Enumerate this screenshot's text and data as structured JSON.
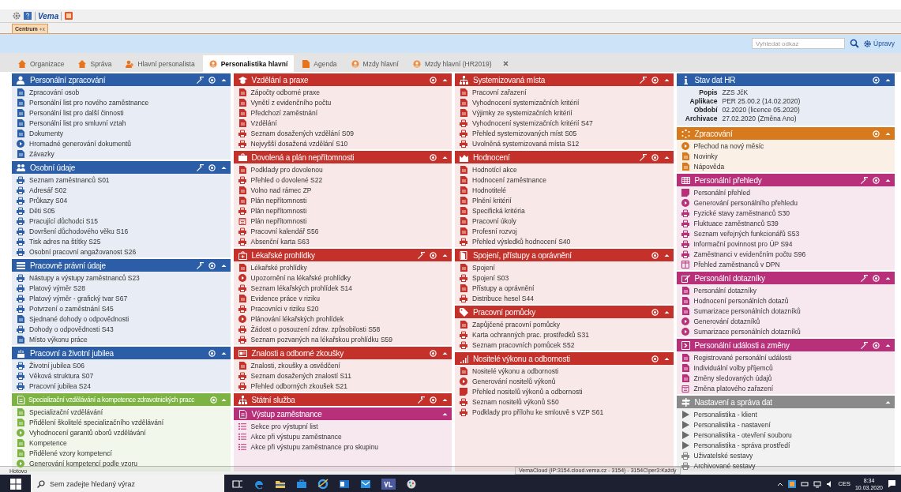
{
  "toolbar": {
    "brand": "Vema"
  },
  "doc_tab": {
    "label": "Centrum"
  },
  "search": {
    "placeholder": "Vyhledat odkaz",
    "edit_label": "Úpravy"
  },
  "tabs": [
    {
      "label": "Organizace",
      "kind": "home",
      "selected": false
    },
    {
      "label": "Správa",
      "kind": "home",
      "selected": false
    },
    {
      "label": "Hlavní personalista",
      "kind": "user",
      "selected": false
    },
    {
      "label": "Personalistika hlavní",
      "kind": "circle",
      "selected": true
    },
    {
      "label": "Agenda",
      "kind": "doc",
      "selected": false
    },
    {
      "label": "Mzdy hlavní",
      "kind": "circle",
      "selected": false
    },
    {
      "label": "Mzdy hlavní (HR2019)",
      "kind": "circle",
      "selected": false
    }
  ],
  "columns": [
    {
      "panels": [
        {
          "title": "Personální zpracování",
          "color": "#2b5ea7",
          "kind": "user",
          "wand": true,
          "settings": true,
          "items": [
            {
              "label": "Zpracování osob",
              "kind": "doc"
            },
            {
              "label": "Personální list pro nového zaměstnance",
              "kind": "doc"
            },
            {
              "label": "Personální list pro další činnosti",
              "kind": "doc"
            },
            {
              "label": "Personální list pro smluvní vztah",
              "kind": "doc"
            },
            {
              "label": "Dokumenty",
              "kind": "doc"
            },
            {
              "label": "Hromadné generování dokumentů",
              "kind": "play"
            },
            {
              "label": "Závazky",
              "kind": "doc"
            }
          ]
        },
        {
          "title": "Osobní údaje",
          "color": "#2b5ea7",
          "kind": "group",
          "wand": true,
          "settings": true,
          "items": [
            {
              "label": "Seznam zaměstnanců S01",
              "kind": "print"
            },
            {
              "label": "Adresář S02",
              "kind": "print"
            },
            {
              "label": "Průkazy S04",
              "kind": "print"
            },
            {
              "label": "Děti S05",
              "kind": "print"
            },
            {
              "label": "Pracující důchodci S15",
              "kind": "print"
            },
            {
              "label": "Dovršení důchodového věku S16",
              "kind": "print"
            },
            {
              "label": "Tisk adres na štítky S25",
              "kind": "print"
            },
            {
              "label": "Osobní pracovní angažovanost S26",
              "kind": "print"
            }
          ]
        },
        {
          "title": "Pracovně právní údaje",
          "color": "#2b5ea7",
          "kind": "list",
          "wand": true,
          "settings": true,
          "items": [
            {
              "label": "Nástupy a výstupy zaměstnanců S23",
              "kind": "print"
            },
            {
              "label": "Platový výměr S28",
              "kind": "print"
            },
            {
              "label": "Platový výměr - grafický tvar S67",
              "kind": "print"
            },
            {
              "label": "Potvrzení o zaměstnání S45",
              "kind": "print"
            },
            {
              "label": "Sjednané dohody o odpovědnosti",
              "kind": "doc"
            },
            {
              "label": "Dohody o odpovědnosti S43",
              "kind": "print"
            },
            {
              "label": "Místo výkonu práce",
              "kind": "doc"
            }
          ]
        },
        {
          "title": "Pracovní a životní jubilea",
          "color": "#2b5ea7",
          "kind": "cake",
          "wand": false,
          "settings": true,
          "items": [
            {
              "label": "Životní jubilea S06",
              "kind": "print"
            },
            {
              "label": "Věková struktura S07",
              "kind": "print"
            },
            {
              "label": "Pracovní jubilea S24",
              "kind": "print"
            }
          ]
        },
        {
          "title": "Specializační vzdělávání a kompetence zdravotnických pracc",
          "color": "#7cb342",
          "kind": "doc",
          "wand": false,
          "settings": true,
          "items": [
            {
              "label": "Specializační vzdělávání",
              "kind": "doc"
            },
            {
              "label": "Přidělení školitelé specializačního vzdělávání",
              "kind": "doc"
            },
            {
              "label": "Vyhodnocení garantů oborů vzdělávání",
              "kind": "play"
            },
            {
              "label": "Kompetence",
              "kind": "doc"
            },
            {
              "label": "Přidělené vzory kompetencí",
              "kind": "doc"
            },
            {
              "label": "Generování kompetencí podle vzoru",
              "kind": "play"
            }
          ]
        }
      ]
    },
    {
      "panels": [
        {
          "title": "Vzdělání a praxe",
          "color": "#c4312b",
          "kind": "hat",
          "wand": false,
          "settings": true,
          "items": [
            {
              "label": "Zápočty odborné praxe",
              "kind": "doc"
            },
            {
              "label": "Vynětí z evidenčního počtu",
              "kind": "doc"
            },
            {
              "label": "Předchozí zaměstnání",
              "kind": "doc"
            },
            {
              "label": "Vzdělání",
              "kind": "doc"
            },
            {
              "label": "Seznam dosažených vzdělání S09",
              "kind": "print"
            },
            {
              "label": "Nejvyšší dosažená vzdělání S10",
              "kind": "print"
            }
          ]
        },
        {
          "title": "Dovolená a plán nepřítomnosti",
          "color": "#c4312b",
          "kind": "case",
          "wand": false,
          "settings": true,
          "items": [
            {
              "label": "Podklady pro dovolenou",
              "kind": "doc"
            },
            {
              "label": "Přehled o dovolené S22",
              "kind": "print"
            },
            {
              "label": "Volno nad rámec ZP",
              "kind": "doc"
            },
            {
              "label": "Plán nepřítomnosti",
              "kind": "doc"
            },
            {
              "label": "Plán nepřítomnosti",
              "kind": "print"
            },
            {
              "label": "Plán nepřítomnosti",
              "kind": "calendar"
            },
            {
              "label": "Pracovní kalendář S56",
              "kind": "print"
            },
            {
              "label": "Absenční karta S63",
              "kind": "print"
            }
          ]
        },
        {
          "title": "Lékařské prohlídky",
          "color": "#c4312b",
          "kind": "kit",
          "wand": true,
          "settings": true,
          "items": [
            {
              "label": "Lékařské prohlídky",
              "kind": "doc"
            },
            {
              "label": "Upozornění na lékařské prohlídky",
              "kind": "play"
            },
            {
              "label": "Seznam lékařských prohlídek S14",
              "kind": "print"
            },
            {
              "label": "Evidence práce v riziku",
              "kind": "doc"
            },
            {
              "label": "Pracovníci v riziku S20",
              "kind": "print"
            },
            {
              "label": "Plánování lékařských prohlídek",
              "kind": "play"
            },
            {
              "label": "Žádost o posouzení zdrav. způsobilosti S58",
              "kind": "print"
            },
            {
              "label": "Seznam pozvaných na lékařskou prohlídku S59",
              "kind": "print"
            }
          ]
        },
        {
          "title": "Znalosti a odborné zkoušky",
          "color": "#c4312b",
          "kind": "card",
          "wand": false,
          "settings": true,
          "items": [
            {
              "label": "Znalosti, zkoušky a osvědčení",
              "kind": "doc"
            },
            {
              "label": "Seznam dosažených znalostí S11",
              "kind": "print"
            },
            {
              "label": "Přehled odborných zkoušek S21",
              "kind": "print"
            }
          ]
        },
        {
          "title": "Státní služba",
          "color": "#c4312b",
          "kind": "tree",
          "wand": true,
          "settings": true
        },
        {
          "title": "Výstup zaměstnance",
          "color": "#b83079",
          "kind": "doc",
          "wand": false,
          "settings": false,
          "items": [
            {
              "label": "Sekce pro výstupní list",
              "kind": "list"
            },
            {
              "label": "Akce při výstupu zaměstnance",
              "kind": "list"
            },
            {
              "label": "Akce při výstupu zaměstnance pro skupinu",
              "kind": "list"
            }
          ]
        }
      ]
    },
    {
      "panels": [
        {
          "title": "Systemizovaná místa",
          "color": "#c4312b",
          "kind": "tree",
          "wand": true,
          "settings": true,
          "items": [
            {
              "label": "Pracovní zařazení",
              "kind": "doc"
            },
            {
              "label": "Vyhodnocení systemizačních kritérií",
              "kind": "doc"
            },
            {
              "label": "Výjimky ze systemizačních kritérií",
              "kind": "doc"
            },
            {
              "label": "Vyhodnocení systemizačních kritérií S47",
              "kind": "print"
            },
            {
              "label": "Přehled systemizovaných míst S05",
              "kind": "print"
            },
            {
              "label": "Uvolněná systemizovaná místa S12",
              "kind": "print"
            }
          ]
        },
        {
          "title": "Hodnocení",
          "color": "#c4312b",
          "kind": "chart",
          "wand": true,
          "settings": true,
          "items": [
            {
              "label": "Hodnotící akce",
              "kind": "doc"
            },
            {
              "label": "Hodnocení zaměstnance",
              "kind": "doc"
            },
            {
              "label": "Hodnotitelé",
              "kind": "doc"
            },
            {
              "label": "Plnění kritérií",
              "kind": "doc"
            },
            {
              "label": "Specifická kritéria",
              "kind": "doc"
            },
            {
              "label": "Pracovní úkoly",
              "kind": "doc"
            },
            {
              "label": "Profesní rozvoj",
              "kind": "doc"
            },
            {
              "label": "Přehled výsledků hodnocení S40",
              "kind": "print"
            }
          ]
        },
        {
          "title": "Spojení, přístupy a oprávnění",
          "color": "#c4312b",
          "kind": "door",
          "wand": false,
          "settings": true,
          "items": [
            {
              "label": "Spojení",
              "kind": "doc"
            },
            {
              "label": "Spojení S03",
              "kind": "print"
            },
            {
              "label": "Přístupy a oprávnění",
              "kind": "doc"
            },
            {
              "label": "Distribuce hesel S44",
              "kind": "print"
            }
          ]
        },
        {
          "title": "Pracovní pomůcky",
          "color": "#c4312b",
          "kind": "tag",
          "wand": false,
          "settings": true,
          "items": [
            {
              "label": "Zapůjčené pracovní pomůcky",
              "kind": "doc"
            },
            {
              "label": "Karta ochranných prac. prostředků S31",
              "kind": "print"
            },
            {
              "label": "Seznam pracovních pomůcek S52",
              "kind": "print"
            }
          ]
        },
        {
          "title": "Nositelé výkonu a odbornosti",
          "color": "#c4312b",
          "kind": "bars",
          "wand": false,
          "settings": true,
          "items": [
            {
              "label": "Nositelé výkonu a odbornosti",
              "kind": "doc"
            },
            {
              "label": "Generování nositelů výkonů",
              "kind": "play"
            },
            {
              "label": "Přehled nositelů výkonů a odbornosti",
              "kind": "note"
            },
            {
              "label": "Seznam nositelů výkonů S50",
              "kind": "print"
            },
            {
              "label": "Podklady pro přílohu ke smlouvě s VZP S61",
              "kind": "print"
            }
          ]
        }
      ]
    },
    {
      "panels": [
        {
          "title": "Stav dat HR",
          "color": "#2b5ea7",
          "kind": "info",
          "wand": false,
          "settings": true,
          "fields": [
            {
              "label": "Popis",
              "value": "ZZS JčK"
            },
            {
              "label": "Aplikace",
              "value": "PER 25.00.2 (14.02.2020)"
            },
            {
              "label": "Období",
              "value": "02.2020 (licence 05.2020)"
            },
            {
              "label": "Archivace",
              "value": "27.02.2020 (Změna Ano)"
            }
          ]
        },
        {
          "title": "Zpracování",
          "color": "#d77a1d",
          "kind": "spinner",
          "wand": false,
          "settings": true,
          "items": [
            {
              "label": "Přechod na nový měsíc",
              "kind": "play"
            },
            {
              "label": "Novinky",
              "kind": "doc"
            },
            {
              "label": "Nápověda",
              "kind": "doc"
            }
          ]
        },
        {
          "title": "Personální přehledy",
          "color": "#b83079",
          "kind": "grid",
          "wand": true,
          "settings": true,
          "items": [
            {
              "label": "Personální přehled",
              "kind": "note"
            },
            {
              "label": "Generování personálního přehledu",
              "kind": "play"
            },
            {
              "label": "Fyzické stavy zaměstnanců S30",
              "kind": "print"
            },
            {
              "label": "Fluktuace zaměstnanců S39",
              "kind": "print"
            },
            {
              "label": "Seznam veřejných funkcionářů S53",
              "kind": "print"
            },
            {
              "label": "Informační povinnost pro ÚP S94",
              "kind": "print"
            },
            {
              "label": "Zaměstnanci v evidenčním počtu S96",
              "kind": "print"
            },
            {
              "label": "Přehled zaměstnanců v DPN",
              "kind": "table"
            }
          ]
        },
        {
          "title": "Personální dotazníky",
          "color": "#b83079",
          "kind": "edit",
          "wand": true,
          "settings": true,
          "items": [
            {
              "label": "Personální dotazníky",
              "kind": "doc"
            },
            {
              "label": "Hodnocení personálních dotazů",
              "kind": "doc"
            },
            {
              "label": "Sumarizace personálních dotazníků",
              "kind": "doc"
            },
            {
              "label": "Generování dotazníků",
              "kind": "play"
            },
            {
              "label": "Sumarizace personálních dotazníků",
              "kind": "play"
            }
          ]
        },
        {
          "title": "Personální události a změny",
          "color": "#b83079",
          "kind": "exit",
          "wand": true,
          "settings": true,
          "items": [
            {
              "label": "Registrované personální události",
              "kind": "doc"
            },
            {
              "label": "Individuální volby příjemců",
              "kind": "doc"
            },
            {
              "label": "Změny sledovaných údajů",
              "kind": "doc"
            },
            {
              "label": "Změna platového zařazení",
              "kind": "calendar"
            }
          ]
        },
        {
          "title": "Nastavení a správa dat",
          "color": "#8a8a8a",
          "kind": "sign",
          "wand": false,
          "settings": false,
          "items": [
            {
              "label": "Personalistika - klient",
              "kind": "arrow"
            },
            {
              "label": "Personalistika - nastavení",
              "kind": "arrow"
            },
            {
              "label": "Personalistika - otevření souboru",
              "kind": "arrow"
            },
            {
              "label": "Personalistika - správa prostředí",
              "kind": "arrow"
            },
            {
              "label": "Uživatelské sestavy",
              "kind": "print"
            },
            {
              "label": "Archivované sestavy",
              "kind": "print"
            }
          ]
        }
      ]
    }
  ],
  "status_bar": {
    "left": "Hotovo",
    "connection": "VemaCloud (IP:3154.cloud.vema.cz - 3154) - 3154C\\per3:Každý"
  },
  "taskbar": {
    "search_placeholder": "Sem zadejte hledaný výraz",
    "language": "CES",
    "time": "8:34",
    "date": "10.03.2020"
  }
}
